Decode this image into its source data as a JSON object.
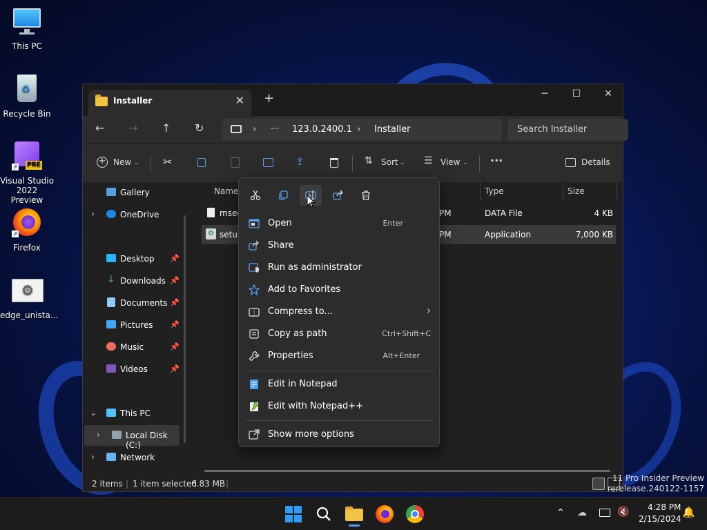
{
  "desktop": {
    "icons": [
      {
        "label": "This PC"
      },
      {
        "label": "Recycle Bin"
      },
      {
        "label": "Visual Studio 2022 Preview",
        "badge": "PRE"
      },
      {
        "label": "Firefox"
      },
      {
        "label": "edge_unista..."
      }
    ]
  },
  "window": {
    "tab_title": "Installer",
    "tab_close": "✕",
    "new_tab": "+",
    "controls": {
      "minimize": "─",
      "maximize": "☐",
      "close": "✕"
    },
    "nav": {
      "back": "←",
      "forward": "→",
      "up": "↑",
      "refresh": "↻"
    },
    "breadcrumb": {
      "ellipsis": "···",
      "sep": "›",
      "item1": "123.0.2400.1",
      "item2": "Installer"
    },
    "search_placeholder": "Search Installer",
    "toolbar": {
      "new_label": "New",
      "sort_label": "Sort",
      "view_label": "View",
      "more": "···",
      "details_label": "Details"
    },
    "sidebar": {
      "gallery": "Gallery",
      "onedrive": "OneDrive",
      "desktop": "Desktop",
      "downloads": "Downloads",
      "documents": "Documents",
      "pictures": "Pictures",
      "music": "Music",
      "videos": "Videos",
      "this_pc": "This PC",
      "local_disk": "Local Disk (C:)",
      "network": "Network"
    },
    "columns": {
      "name": "Name",
      "type": "Type",
      "size": "Size"
    },
    "files": [
      {
        "name": "msed",
        "date_tail": "PM",
        "type": "DATA File",
        "size": "4 KB"
      },
      {
        "name": "setup",
        "date_tail": "PM",
        "type": "Application",
        "size": "7,000 KB"
      }
    ],
    "status": {
      "items": "2 items",
      "selected": "1 item selected",
      "size": "6.83 MB"
    }
  },
  "context_menu": {
    "items": [
      {
        "label": "Open",
        "shortcut": "Enter"
      },
      {
        "label": "Share",
        "shortcut": ""
      },
      {
        "label": "Run as administrator",
        "shortcut": ""
      },
      {
        "label": "Add to Favorites",
        "shortcut": ""
      },
      {
        "label": "Compress to...",
        "shortcut": "›"
      },
      {
        "label": "Copy as path",
        "shortcut": "Ctrl+Shift+C"
      },
      {
        "label": "Properties",
        "shortcut": "Alt+Enter"
      },
      {
        "label": "Edit in Notepad",
        "shortcut": ""
      },
      {
        "label": "Edit with Notepad++",
        "shortcut": ""
      },
      {
        "label": "Show more options",
        "shortcut": ""
      }
    ]
  },
  "taskbar": {
    "time": "4:28 PM",
    "date": "2/15/2024",
    "watermark_line1": "11 Pro Insider Preview",
    "watermark_line2": "rerelease.240122-1157",
    "tray_arrow": "^"
  },
  "colors": {
    "accent": "#0078d4",
    "folder": "#f0c246",
    "selection": "#3a3a3a"
  }
}
